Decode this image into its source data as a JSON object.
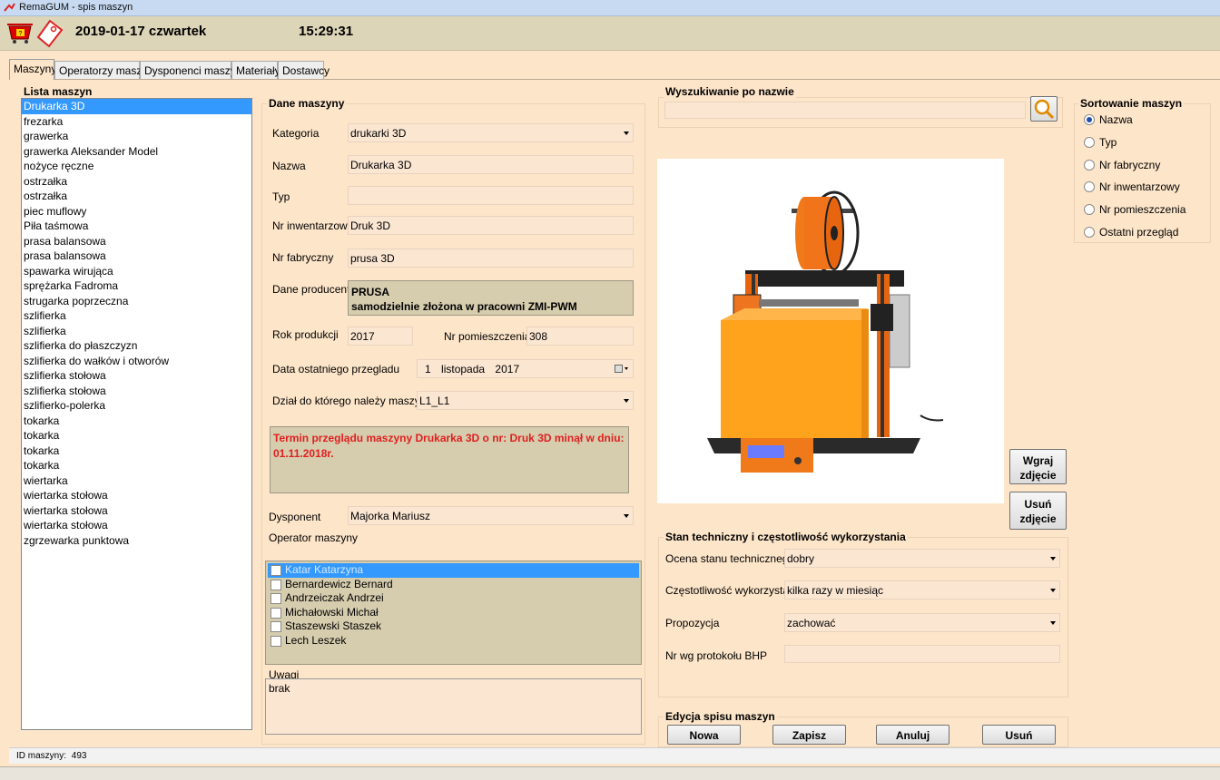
{
  "window": {
    "title": "RemaGUM - spis maszyn"
  },
  "header": {
    "date": "2019-01-17 czwartek",
    "time": "15:29:31"
  },
  "tabs": [
    "Maszyny",
    "Operatorzy maszyn",
    "Dysponenci maszyn",
    "Materiały",
    "Dostawcy"
  ],
  "machine_list": {
    "label": "Lista maszyn",
    "items": [
      "Drukarka 3D",
      "frezarka",
      "grawerka",
      "grawerka Aleksander Model",
      "nożyce ręczne",
      "ostrzałka",
      "ostrzałka",
      "piec muflowy",
      "Piła taśmowa",
      "prasa balansowa",
      "prasa balansowa",
      "spawarka wirująca",
      "sprężarka Fadroma",
      "strugarka poprzeczna",
      "szlifierka",
      "szlifierka",
      "szlifierka do płaszczyzn",
      "szlifierka do wałków i otworów",
      "szlifierka stołowa",
      "szlifierka stołowa",
      "szlifierko-polerka",
      "tokarka",
      "tokarka",
      "tokarka",
      "tokarka",
      "wiertarka",
      "wiertarka stołowa",
      "wiertarka stołowa",
      "wiertarka stołowa",
      "zgrzewarka punktowa"
    ],
    "selected_index": 0
  },
  "machine": {
    "label": "Dane maszyny",
    "category_label": "Kategoria",
    "category": "drukarki 3D",
    "name_label": "Nazwa",
    "name": "Drukarka 3D",
    "type_label": "Typ",
    "type": "",
    "inventory_label": "Nr inwentarzowy",
    "inventory": "Druk 3D",
    "factory_label": "Nr fabryczny",
    "factory": "prusa 3D",
    "producer_label": "Dane producenta",
    "producer_line1": "PRUSA",
    "producer_line2": "samodzielnie złożona w pracowni ZMI-PWM",
    "year_label": "Rok produkcji",
    "year": "2017",
    "room_label": "Nr pomieszczenia",
    "room": "308",
    "inspection_label": "Data ostatniego przegladu",
    "inspection_day": "1",
    "inspection_month": "listopada",
    "inspection_year": "2017",
    "dept_label": "Dział do którego należy maszyna",
    "dept": "L1_L1",
    "warning": "Termin przeglądu maszyny Drukarka 3D o nr: Druk 3D minął w dniu: 01.11.2018r.",
    "warning_color": "#e02020",
    "dispatcher_label": "Dysponent",
    "dispatcher": "Majorka Mariusz",
    "operators_label": "Operator maszyny",
    "operators": [
      "Katar Katarzyna",
      "Bernardewicz Bernard",
      "Andrzeiczak Andrzei",
      "Michałowski Michał",
      "Staszewski Staszek",
      "Lech Leszek"
    ],
    "operators_selected_index": 0,
    "notes_label": "Uwagi",
    "notes": "brak"
  },
  "search": {
    "label": "Wyszukiwanie po nazwie",
    "value": "",
    "icon": "search-icon"
  },
  "photo": {
    "upload_btn": "Wgraj zdjęcie",
    "delete_btn": "Usuń zdjęcie"
  },
  "condition": {
    "label": "Stan techniczny i częstotliwość wykorzystania",
    "rating_label": "Ocena stanu technicznego",
    "rating": "dobry",
    "frequency_label": "Częstotliwość wykorzystania",
    "frequency": "kilka razy w miesiąc",
    "proposal_label": "Propozycja",
    "proposal": "zachować",
    "bhp_label": "Nr wg protokołu BHP",
    "bhp": ""
  },
  "sorting": {
    "label": "Sortowanie maszyn",
    "options": [
      "Nazwa",
      "Typ",
      "Nr fabryczny",
      "Nr inwentarzowy",
      "Nr pomieszczenia",
      "Ostatni przegląd"
    ],
    "selected_index": 0
  },
  "edit": {
    "label": "Edycja spisu maszyn",
    "new": "Nowa",
    "save": "Zapisz",
    "cancel": "Anuluj",
    "delete": "Usuń"
  },
  "status": {
    "id_label": "ID maszyny:",
    "id": "493"
  }
}
